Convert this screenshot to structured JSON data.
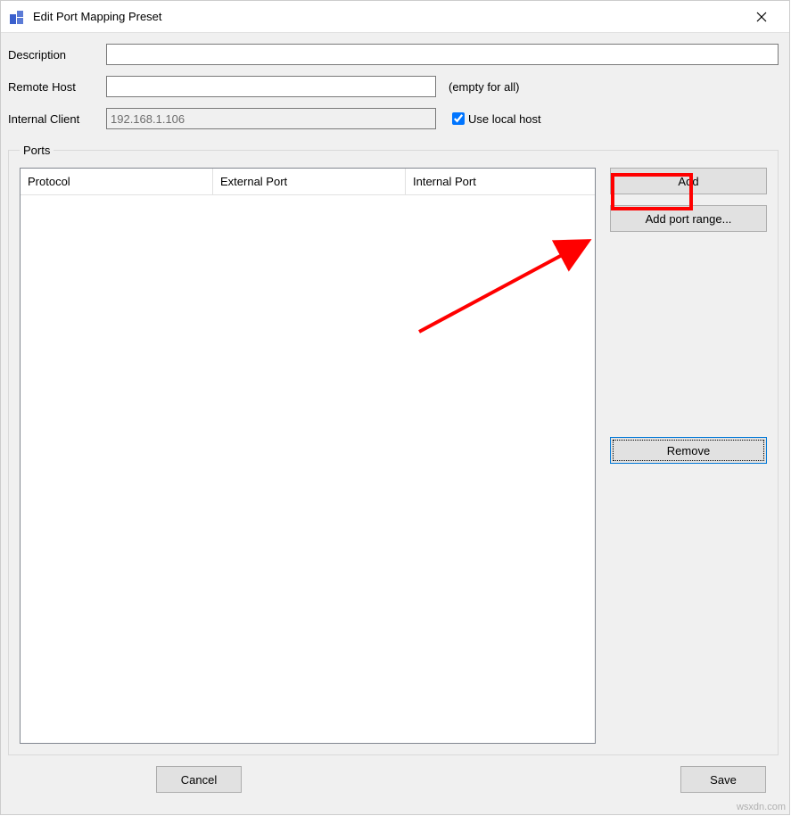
{
  "window": {
    "title": "Edit Port Mapping Preset"
  },
  "form": {
    "description_label": "Description",
    "description_value": "",
    "remote_host_label": "Remote Host",
    "remote_host_value": "",
    "remote_host_hint": "(empty for all)",
    "internal_client_label": "Internal Client",
    "internal_client_value": "192.168.1.106",
    "use_local_host_label": "Use local host",
    "use_local_host_checked": true
  },
  "ports": {
    "legend": "Ports",
    "columns": {
      "protocol": "Protocol",
      "external": "External Port",
      "internal": "Internal Port"
    },
    "rows": []
  },
  "buttons": {
    "add": "Add",
    "add_port_range": "Add port range...",
    "remove": "Remove",
    "cancel": "Cancel",
    "save": "Save"
  },
  "watermark": "wsxdn.com"
}
